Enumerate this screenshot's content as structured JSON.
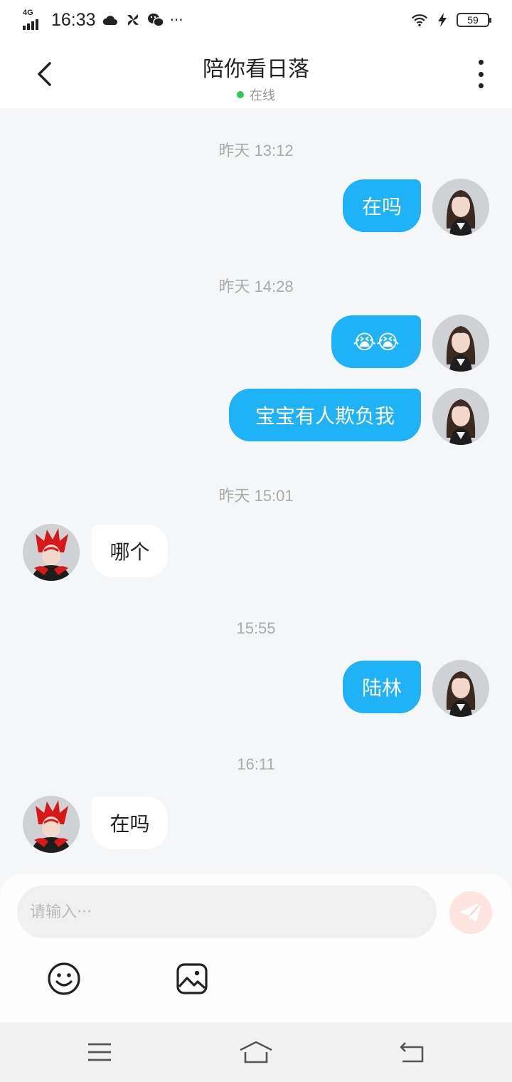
{
  "status_bar": {
    "network": "4G",
    "time": "16:33",
    "battery": "59",
    "more": "···",
    "icons": [
      "cloud-icon",
      "pinwheel-icon",
      "wechat-icon",
      "wifi-icon",
      "charging-icon"
    ]
  },
  "header": {
    "title": "陪你看日落",
    "status": "在线",
    "status_color": "#2ec94e"
  },
  "messages": [
    {
      "type": "timestamp",
      "text": "昨天 13:12"
    },
    {
      "type": "sent",
      "text": "在吗"
    },
    {
      "type": "timestamp",
      "text": "昨天 14:28"
    },
    {
      "type": "sent",
      "text": "😭😭"
    },
    {
      "type": "sent",
      "text": "宝宝有人欺负我"
    },
    {
      "type": "timestamp",
      "text": "昨天 15:01"
    },
    {
      "type": "received",
      "text": "哪个"
    },
    {
      "type": "timestamp",
      "text": "15:55"
    },
    {
      "type": "sent",
      "text": "陆林"
    },
    {
      "type": "timestamp",
      "text": "16:11"
    },
    {
      "type": "received",
      "text": "在吗"
    }
  ],
  "input": {
    "placeholder": "请输入···",
    "value": ""
  },
  "colors": {
    "sent_bubble": "#1fb2f7",
    "received_bubble": "#ffffff",
    "background": "#f4f6f7",
    "send_button": "#ffe4df"
  },
  "toolbar": [
    "emoji-icon",
    "image-icon"
  ],
  "nav": [
    "menu-icon",
    "home-icon",
    "back-icon"
  ]
}
